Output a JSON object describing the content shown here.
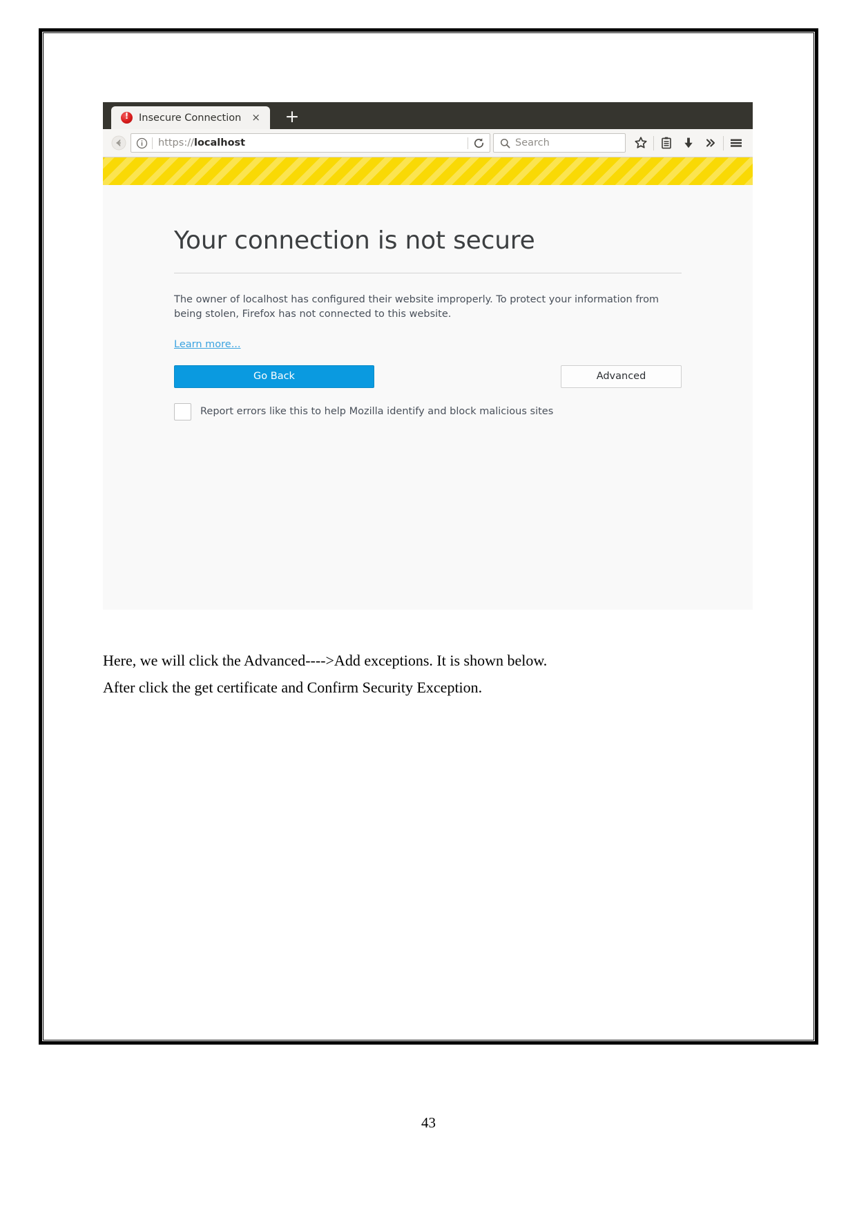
{
  "document": {
    "paragraphs": [
      "Here, we will click the Advanced---->Add exceptions. It is shown below.",
      "After click the get certificate and Confirm Security Exception."
    ],
    "page_number": "43"
  },
  "browser": {
    "tab": {
      "title": "Insecure Connection",
      "close_label": "×",
      "favicon_name": "insecure-warning-icon"
    },
    "new_tab_label": "+",
    "toolbar": {
      "back_icon": "back-arrow-icon",
      "identity_icon": "info-circle-icon",
      "url_prefix": "https://",
      "url_host": "localhost",
      "reload_icon": "reload-icon",
      "search_placeholder": "Search",
      "search_icon": "magnifier-icon",
      "bookmark_icon": "star-icon",
      "library_icon": "library-icon",
      "downloads_icon": "download-arrow-icon",
      "overflow_icon": "chevron-double-right-icon",
      "menu_icon": "hamburger-menu-icon"
    },
    "colors": {
      "tabstrip_bg": "#36352f",
      "toolbar_bg": "#f6f5f3",
      "stripe_yellow": "#f9d905",
      "error_bg": "#f9f9f9",
      "primary_button": "#0a9ae0",
      "link": "#3ba3e0"
    },
    "error_page": {
      "title": "Your connection is not secure",
      "body": "The owner of localhost has configured their website improperly. To protect your information from being stolen, Firefox has not connected to this website.",
      "learn_more": "Learn more...",
      "go_back_label": "Go Back",
      "advanced_label": "Advanced",
      "report_label": "Report errors like this to help Mozilla identify and block malicious sites"
    }
  }
}
